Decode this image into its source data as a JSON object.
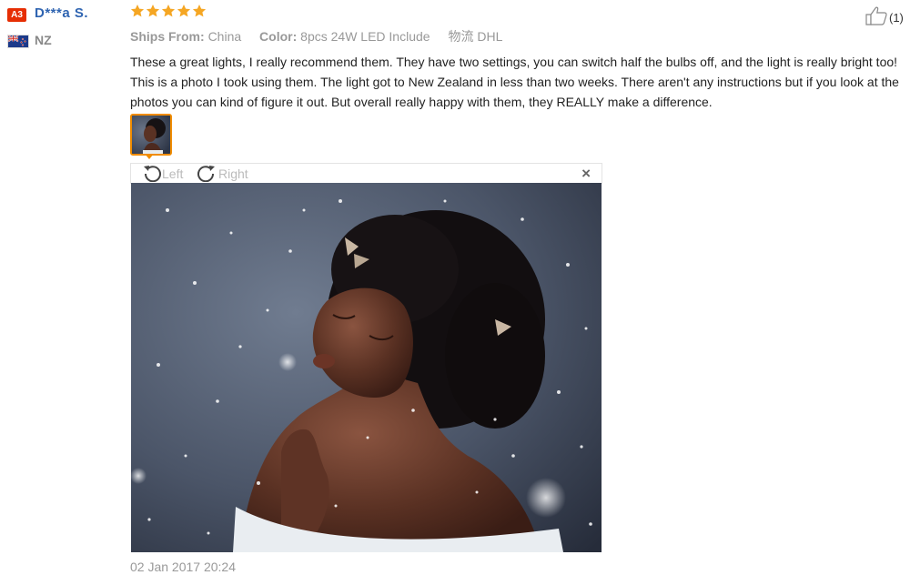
{
  "user": {
    "level_badge": "A3",
    "name": "D***a S.",
    "country": "NZ"
  },
  "rating": {
    "stars": 5,
    "max": 5,
    "color": "#f5a623"
  },
  "meta": {
    "ships_from_label": "Ships From:",
    "ships_from_value": "China",
    "color_label": "Color:",
    "color_value": "8pcs 24W LED Include",
    "shipping_label": "物流",
    "shipping_value": "DHL"
  },
  "review": {
    "text": "These a great lights, I really recommend them. They have two settings, you can switch half the bulbs off, and the light is really bright too! This is a photo I took using them. The light got to New Zealand in less than two weeks. There aren't any instructions but if you look at the photos you can kind of figure it out. But overall really happy with them, they REALLY make a difference."
  },
  "helpful": {
    "count": "(1)",
    "icon": "thumbs-up-icon"
  },
  "viewer": {
    "rotate_left_label": "Left",
    "rotate_right_label": "Right",
    "close_glyph": "×",
    "rotate_left_icon": "rotate-left-icon",
    "rotate_right_icon": "rotate-right-icon",
    "close_icon": "close-icon"
  },
  "timestamp": "02 Jan 2017 20:24",
  "colors": {
    "accent_orange": "#f08c00",
    "username_blue": "#2f64b1",
    "badge_red": "#e62e04"
  }
}
